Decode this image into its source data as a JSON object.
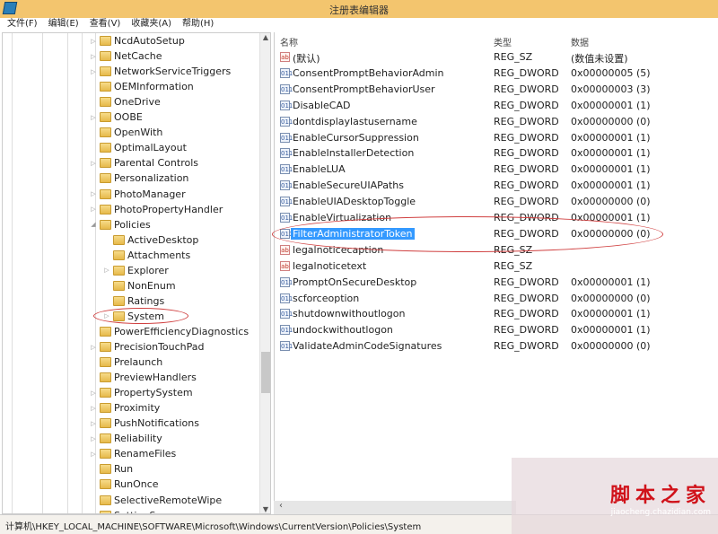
{
  "window": {
    "title": "注册表编辑器",
    "icon": "registry-editor-icon"
  },
  "menu": [
    "文件(F)",
    "编辑(E)",
    "查看(V)",
    "收藏夹(A)",
    "帮助(H)"
  ],
  "tree": [
    {
      "label": "NcdAutoSetup",
      "level": 1,
      "expander": "collapsed"
    },
    {
      "label": "NetCache",
      "level": 1,
      "expander": "collapsed"
    },
    {
      "label": "NetworkServiceTriggers",
      "level": 1,
      "expander": "collapsed"
    },
    {
      "label": "OEMInformation",
      "level": 1,
      "expander": "none"
    },
    {
      "label": "OneDrive",
      "level": 1,
      "expander": "none"
    },
    {
      "label": "OOBE",
      "level": 1,
      "expander": "collapsed"
    },
    {
      "label": "OpenWith",
      "level": 1,
      "expander": "none"
    },
    {
      "label": "OptimalLayout",
      "level": 1,
      "expander": "none"
    },
    {
      "label": "Parental Controls",
      "level": 1,
      "expander": "collapsed"
    },
    {
      "label": "Personalization",
      "level": 1,
      "expander": "none"
    },
    {
      "label": "PhotoManager",
      "level": 1,
      "expander": "collapsed"
    },
    {
      "label": "PhotoPropertyHandler",
      "level": 1,
      "expander": "collapsed"
    },
    {
      "label": "Policies",
      "level": 1,
      "expander": "expanded"
    },
    {
      "label": "ActiveDesktop",
      "level": 2,
      "expander": "none"
    },
    {
      "label": "Attachments",
      "level": 2,
      "expander": "none"
    },
    {
      "label": "Explorer",
      "level": 2,
      "expander": "collapsed"
    },
    {
      "label": "NonEnum",
      "level": 2,
      "expander": "none"
    },
    {
      "label": "Ratings",
      "level": 2,
      "expander": "none"
    },
    {
      "label": "System",
      "level": 2,
      "expander": "collapsed",
      "highlighted": true
    },
    {
      "label": "PowerEfficiencyDiagnostics",
      "level": 1,
      "expander": "none"
    },
    {
      "label": "PrecisionTouchPad",
      "level": 1,
      "expander": "collapsed"
    },
    {
      "label": "Prelaunch",
      "level": 1,
      "expander": "none"
    },
    {
      "label": "PreviewHandlers",
      "level": 1,
      "expander": "none"
    },
    {
      "label": "PropertySystem",
      "level": 1,
      "expander": "collapsed"
    },
    {
      "label": "Proximity",
      "level": 1,
      "expander": "collapsed"
    },
    {
      "label": "PushNotifications",
      "level": 1,
      "expander": "collapsed"
    },
    {
      "label": "Reliability",
      "level": 1,
      "expander": "collapsed"
    },
    {
      "label": "RenameFiles",
      "level": 1,
      "expander": "collapsed"
    },
    {
      "label": "Run",
      "level": 1,
      "expander": "none"
    },
    {
      "label": "RunOnce",
      "level": 1,
      "expander": "none"
    },
    {
      "label": "SelectiveRemoteWipe",
      "level": 1,
      "expander": "none"
    },
    {
      "label": "SettingSync",
      "level": 1,
      "expander": "none"
    }
  ],
  "columns": {
    "name": "名称",
    "type": "类型",
    "data": "数据"
  },
  "values": [
    {
      "name": "(默认)",
      "type": "REG_SZ",
      "data": "(数值未设置)"
    },
    {
      "name": "ConsentPromptBehaviorAdmin",
      "type": "REG_DWORD",
      "data": "0x00000005 (5)"
    },
    {
      "name": "ConsentPromptBehaviorUser",
      "type": "REG_DWORD",
      "data": "0x00000003 (3)"
    },
    {
      "name": "DisableCAD",
      "type": "REG_DWORD",
      "data": "0x00000001 (1)"
    },
    {
      "name": "dontdisplaylastusername",
      "type": "REG_DWORD",
      "data": "0x00000000 (0)"
    },
    {
      "name": "EnableCursorSuppression",
      "type": "REG_DWORD",
      "data": "0x00000001 (1)"
    },
    {
      "name": "EnableInstallerDetection",
      "type": "REG_DWORD",
      "data": "0x00000001 (1)"
    },
    {
      "name": "EnableLUA",
      "type": "REG_DWORD",
      "data": "0x00000001 (1)"
    },
    {
      "name": "EnableSecureUIAPaths",
      "type": "REG_DWORD",
      "data": "0x00000001 (1)"
    },
    {
      "name": "EnableUIADesktopToggle",
      "type": "REG_DWORD",
      "data": "0x00000000 (0)"
    },
    {
      "name": "EnableVirtualization",
      "type": "REG_DWORD",
      "data": "0x00000001 (1)"
    },
    {
      "name": "FilterAdministratorToken",
      "type": "REG_DWORD",
      "data": "0x00000000 (0)",
      "selected": true
    },
    {
      "name": "legalnoticecaption",
      "type": "REG_SZ",
      "data": ""
    },
    {
      "name": "legalnoticetext",
      "type": "REG_SZ",
      "data": ""
    },
    {
      "name": "PromptOnSecureDesktop",
      "type": "REG_DWORD",
      "data": "0x00000001 (1)"
    },
    {
      "name": "scforceoption",
      "type": "REG_DWORD",
      "data": "0x00000000 (0)"
    },
    {
      "name": "shutdownwithoutlogon",
      "type": "REG_DWORD",
      "data": "0x00000001 (1)"
    },
    {
      "name": "undockwithoutlogon",
      "type": "REG_DWORD",
      "data": "0x00000001 (1)"
    },
    {
      "name": "ValidateAdminCodeSignatures",
      "type": "REG_DWORD",
      "data": "0x00000000 (0)"
    }
  ],
  "status_path": "计算机\\HKEY_LOCAL_MACHINE\\SOFTWARE\\Microsoft\\Windows\\CurrentVersion\\Policies\\System",
  "watermark": {
    "line1": "脚本之家",
    "line2": "jiaocheng.chazidian.com"
  },
  "colors": {
    "titlebar": "#f3c56e",
    "selection": "#3399ff",
    "annotation": "#d04040"
  }
}
